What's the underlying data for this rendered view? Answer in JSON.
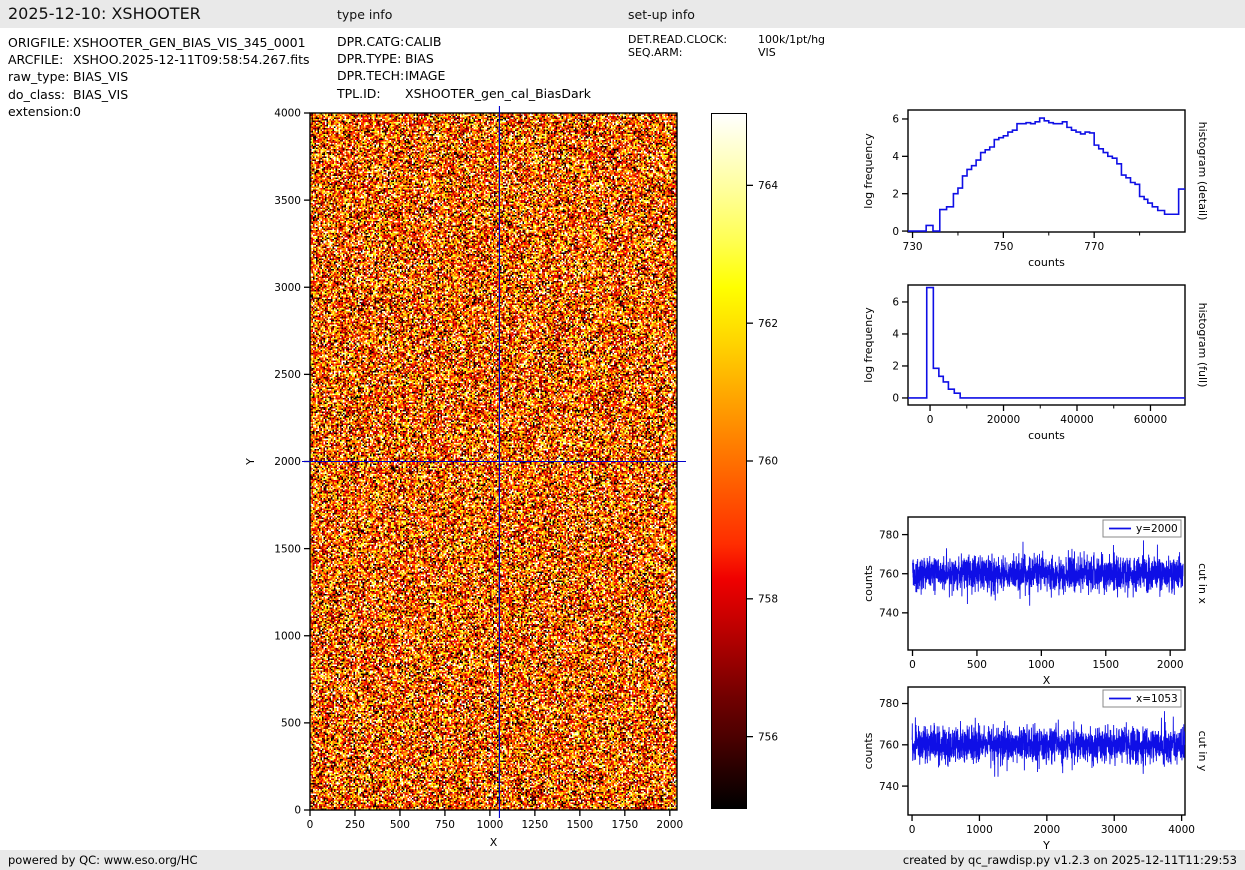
{
  "header": {
    "title": "2025-12-10: XSHOOTER",
    "sections": {
      "type_info": "type info",
      "setup_info": "set-up info"
    }
  },
  "file_info": {
    "rows": [
      {
        "label": "ORIGFILE:",
        "value": "XSHOOTER_GEN_BIAS_VIS_345_0001"
      },
      {
        "label": "ARCFILE:",
        "value": "XSHOO.2025-12-11T09:58:54.267.fits"
      },
      {
        "label": "raw_type:",
        "value": "BIAS_VIS"
      },
      {
        "label": "do_class:",
        "value": "BIAS_VIS"
      },
      {
        "label": "extension:",
        "value": "0"
      }
    ]
  },
  "type_info": {
    "rows": [
      {
        "label": "DPR.CATG:",
        "value": "CALIB"
      },
      {
        "label": "DPR.TYPE:",
        "value": "BIAS"
      },
      {
        "label": "DPR.TECH:",
        "value": "IMAGE"
      },
      {
        "label": "TPL.ID:",
        "value": "XSHOOTER_gen_cal_BiasDark"
      }
    ]
  },
  "setup_info": {
    "rows": [
      {
        "label": "DET.READ.CLOCK:",
        "value": "100k/1pt/hg"
      },
      {
        "label": "SEQ.ARM:",
        "value": "VIS"
      }
    ]
  },
  "footer": {
    "left": "powered by QC: www.eso.org/HC",
    "right": "created by qc_rawdisp.py v1.2.3 on 2025-12-11T11:29:53"
  },
  "colors": {
    "series_blue": "#0f0fe6",
    "crosshair_blue": "#0000cc",
    "header_bg": "#e9e9e9",
    "frame": "#000000"
  },
  "chart_data": [
    {
      "id": "main_image",
      "type": "heatmap",
      "xlabel": "X",
      "ylabel": "Y",
      "xlim": [
        0,
        2040
      ],
      "ylim": [
        0,
        4000
      ],
      "xticks": {
        "major": [
          0,
          250,
          500,
          750,
          1000,
          1250,
          1500,
          1750,
          2000
        ]
      },
      "yticks": {
        "major": [
          0,
          500,
          1000,
          1500,
          2000,
          2500,
          3000,
          3500,
          4000
        ]
      },
      "crosshair": {
        "x": 1053,
        "y": 2000
      },
      "colormap": "hot",
      "value_range": [
        754.95,
        765.05
      ],
      "noise": {
        "mean": 760,
        "sigma": 3.2,
        "seed": 1234
      }
    },
    {
      "id": "colorbar",
      "type": "colorbar",
      "ticks": [
        764,
        762,
        760,
        758,
        756
      ],
      "vmin": 754.95,
      "vmax": 765.05
    },
    {
      "id": "hist_detail",
      "type": "step",
      "xlabel": "counts",
      "ylabel": "log frequency",
      "right_label": "histogram (detail)",
      "xlim": [
        729,
        790
      ],
      "ylim": [
        -0.05,
        6.48
      ],
      "xticks": {
        "major": [
          730,
          750,
          770
        ],
        "minor": [
          740,
          760,
          780
        ]
      },
      "yticks": {
        "major": [
          0,
          2,
          4,
          6
        ]
      },
      "steps": [
        [
          729,
          0
        ],
        [
          733,
          0
        ],
        [
          733,
          0.3
        ],
        [
          734.5,
          0.3
        ],
        [
          734.5,
          0
        ],
        [
          736,
          0
        ],
        [
          736,
          1.15
        ],
        [
          737.5,
          1.15
        ],
        [
          737.5,
          1.3
        ],
        [
          739,
          1.3
        ],
        [
          739,
          2.0
        ],
        [
          740,
          2.0
        ],
        [
          740,
          2.3
        ],
        [
          741,
          2.3
        ],
        [
          741,
          2.95
        ],
        [
          742,
          2.95
        ],
        [
          742,
          3.3
        ],
        [
          743,
          3.3
        ],
        [
          743,
          3.5
        ],
        [
          744,
          3.5
        ],
        [
          744,
          3.8
        ],
        [
          745,
          3.8
        ],
        [
          745,
          4.2
        ],
        [
          746,
          4.2
        ],
        [
          746,
          4.35
        ],
        [
          747,
          4.35
        ],
        [
          747,
          4.5
        ],
        [
          748,
          4.5
        ],
        [
          748,
          4.9
        ],
        [
          749,
          4.9
        ],
        [
          749,
          5.0
        ],
        [
          750,
          5.0
        ],
        [
          750,
          5.1
        ],
        [
          751,
          5.1
        ],
        [
          751,
          5.3
        ],
        [
          752,
          5.3
        ],
        [
          752,
          5.4
        ],
        [
          753,
          5.4
        ],
        [
          753,
          5.75
        ],
        [
          755,
          5.75
        ],
        [
          755,
          5.8
        ],
        [
          756,
          5.8
        ],
        [
          756,
          5.75
        ],
        [
          757,
          5.75
        ],
        [
          757,
          5.85
        ],
        [
          758,
          5.85
        ],
        [
          758,
          6.05
        ],
        [
          759,
          6.05
        ],
        [
          759,
          5.9
        ],
        [
          760,
          5.9
        ],
        [
          760,
          5.8
        ],
        [
          761,
          5.8
        ],
        [
          761,
          5.75
        ],
        [
          763,
          5.75
        ],
        [
          763,
          5.85
        ],
        [
          764,
          5.85
        ],
        [
          764,
          5.55
        ],
        [
          765,
          5.55
        ],
        [
          765,
          5.4
        ],
        [
          766,
          5.4
        ],
        [
          766,
          5.3
        ],
        [
          767,
          5.3
        ],
        [
          767,
          5.2
        ],
        [
          768,
          5.2
        ],
        [
          768,
          5.3
        ],
        [
          769,
          5.3
        ],
        [
          769,
          5.25
        ],
        [
          770,
          5.25
        ],
        [
          770,
          4.6
        ],
        [
          771,
          4.6
        ],
        [
          771,
          4.4
        ],
        [
          772,
          4.4
        ],
        [
          772,
          4.2
        ],
        [
          773,
          4.2
        ],
        [
          773,
          4.0
        ],
        [
          774,
          4.0
        ],
        [
          774,
          3.9
        ],
        [
          775,
          3.9
        ],
        [
          775,
          3.6
        ],
        [
          776,
          3.6
        ],
        [
          776,
          3.0
        ],
        [
          777,
          3.0
        ],
        [
          777,
          2.85
        ],
        [
          778,
          2.85
        ],
        [
          778,
          2.6
        ],
        [
          779,
          2.6
        ],
        [
          779,
          2.5
        ],
        [
          780,
          2.5
        ],
        [
          780,
          1.85
        ],
        [
          781,
          1.85
        ],
        [
          781,
          1.7
        ],
        [
          781.8,
          1.7
        ],
        [
          781.8,
          1.5
        ],
        [
          782.8,
          1.5
        ],
        [
          782.8,
          1.3
        ],
        [
          784,
          1.3
        ],
        [
          784,
          1.1
        ],
        [
          785.5,
          1.1
        ],
        [
          785.5,
          0.9
        ],
        [
          788.6,
          0.9
        ],
        [
          788.6,
          2.25
        ],
        [
          790,
          2.25
        ]
      ]
    },
    {
      "id": "hist_full",
      "type": "step",
      "xlabel": "counts",
      "ylabel": "log frequency",
      "right_label": "histogram (full)",
      "xlim": [
        -6000,
        69400
      ],
      "ylim": [
        -0.44,
        7.06
      ],
      "xticks": {
        "major": [
          0,
          20000,
          40000,
          60000
        ],
        "minor": [
          10000,
          30000,
          50000
        ]
      },
      "yticks": {
        "major": [
          0,
          2,
          4,
          6
        ]
      },
      "steps": [
        [
          -6000,
          0
        ],
        [
          -900,
          0
        ],
        [
          -900,
          6.9
        ],
        [
          900,
          6.9
        ],
        [
          900,
          1.85
        ],
        [
          2400,
          1.85
        ],
        [
          2400,
          1.35
        ],
        [
          3600,
          1.35
        ],
        [
          3600,
          1.0
        ],
        [
          5000,
          1.0
        ],
        [
          5000,
          0.55
        ],
        [
          6600,
          0.55
        ],
        [
          6600,
          0.3
        ],
        [
          8200,
          0.3
        ],
        [
          8200,
          0
        ],
        [
          69400,
          0
        ]
      ]
    },
    {
      "id": "cut_x",
      "type": "line",
      "xlabel": "X",
      "ylabel": "counts",
      "right_label": "cut in x",
      "legend": "y=2000",
      "xlim": [
        -35,
        2115
      ],
      "ylim": [
        721,
        789
      ],
      "xticks": {
        "major": [
          0,
          500,
          1000,
          1500,
          2000
        ]
      },
      "yticks": {
        "major": [
          740,
          760,
          780
        ]
      },
      "noise": {
        "mean": 760,
        "sigma": 4.4,
        "n": 2100,
        "x0": 0,
        "x1": 2100,
        "seed": 77
      }
    },
    {
      "id": "cut_y",
      "type": "line",
      "xlabel": "Y",
      "ylabel": "counts",
      "right_label": "cut in y",
      "legend": "x=1053",
      "xlim": [
        -60,
        4050
      ],
      "ylim": [
        726,
        788
      ],
      "xticks": {
        "major": [
          0,
          1000,
          2000,
          3000,
          4000
        ]
      },
      "yticks": {
        "major": [
          740,
          760,
          780
        ]
      },
      "noise": {
        "mean": 760,
        "sigma": 4.4,
        "n": 2050,
        "x0": 0,
        "x1": 4046,
        "seed": 99
      }
    }
  ]
}
